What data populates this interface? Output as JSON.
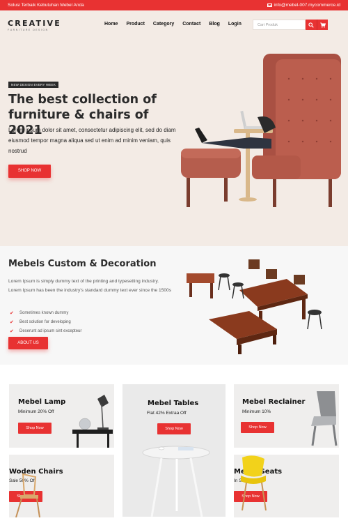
{
  "topbar": {
    "tagline": "Solusi Terbaik Kebutuhan Mebel Anda",
    "email": "info@mebel-007.mycommerce.id"
  },
  "header": {
    "logo_name": "CREATIVE",
    "logo_tag": "FURNITURE DESIGN",
    "nav": [
      "Home",
      "Product",
      "Category",
      "Contact",
      "Blog",
      "Login"
    ],
    "search_placeholder": "Cari Produk"
  },
  "hero": {
    "badge": "NEW DESIGN EVERY WEEK",
    "title": "The best collection of furniture & chairs of 2021",
    "description": "Lorem ipsum dolor sit amet, consectetur adipiscing elit, sed do diam eiusmod tempor magna aliqua sed ut enim ad minim veniam, quis nostrud",
    "button": "SHOP NOW"
  },
  "custom": {
    "title": "Mebels Custom & Decoration",
    "description": "Lorem Ipsum is simply dummy text of the printing and typesetting industry. Lorem Ipsum has been the industry's standard dummy text ever since the 1500s",
    "features": [
      "Sometimes known dummy",
      "Best solution for developing",
      "Deserunt ad ipsum sint excepteur"
    ],
    "button": "ABOUT US"
  },
  "categories": [
    {
      "title": "Mebel Lamp",
      "subtitle": "Minimum 20% Off",
      "button": "Shop Now"
    },
    {
      "title": "Mebel Tables",
      "subtitle": "Flat 42% Extraa Off",
      "button": "Shop Now"
    },
    {
      "title": "Mebel Reclainer",
      "subtitle": "Minimum 10%",
      "button": "Shop Now"
    },
    {
      "title": "Woden Chairs",
      "subtitle": "Sale 50% Off",
      "button": "Shop Now"
    },
    {
      "title": "Mebel Seats",
      "subtitle": "In Stock 100%",
      "button": "Shop Now"
    }
  ],
  "colors": {
    "accent": "#e83232",
    "hero_bg": "#f3ebe5",
    "chair": "#b95a4a"
  }
}
